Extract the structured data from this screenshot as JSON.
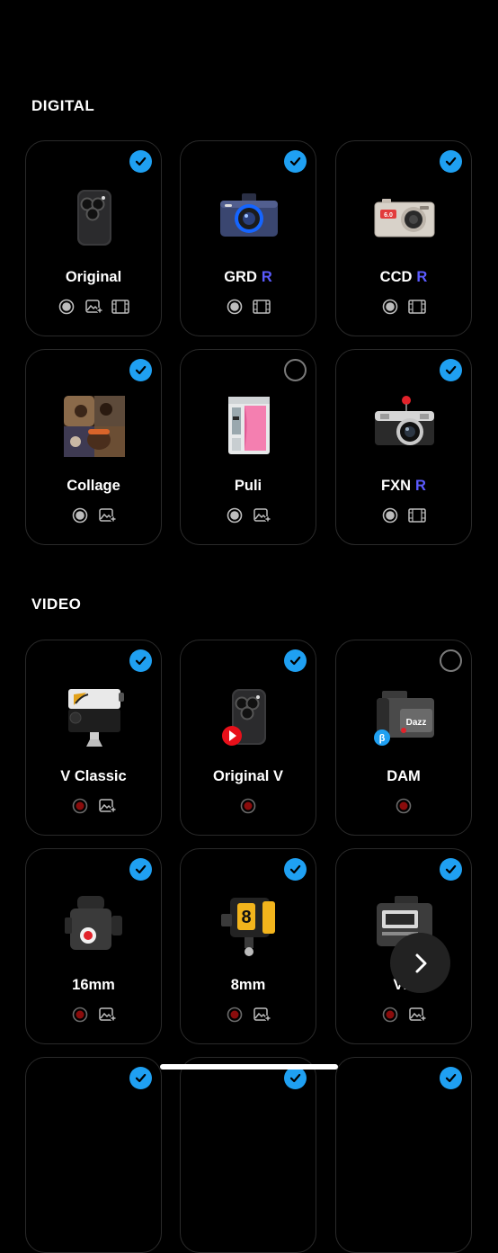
{
  "sections": [
    {
      "title": "DIGITAL",
      "cards": [
        {
          "name": "Original",
          "suffix": "",
          "checked": true,
          "icon": "phone-camera-icon",
          "features": [
            "shutter-icon",
            "photo-import-icon",
            "film-icon"
          ]
        },
        {
          "name": "GRD",
          "suffix": "R",
          "checked": true,
          "icon": "blue-digital-camera-icon",
          "features": [
            "shutter-icon",
            "film-icon"
          ]
        },
        {
          "name": "CCD",
          "suffix": "R",
          "checked": true,
          "icon": "silver-compact-camera-icon",
          "features": [
            "shutter-icon",
            "film-icon"
          ]
        },
        {
          "name": "Collage",
          "suffix": "",
          "checked": true,
          "icon": "photo-collage-icon",
          "features": [
            "shutter-icon",
            "photo-import-icon"
          ]
        },
        {
          "name": "Puli",
          "suffix": "",
          "checked": false,
          "icon": "photo-booth-icon",
          "features": [
            "shutter-icon",
            "photo-import-icon"
          ]
        },
        {
          "name": "FXN",
          "suffix": "R",
          "checked": true,
          "icon": "rangefinder-camera-icon",
          "features": [
            "shutter-icon",
            "film-icon"
          ]
        }
      ]
    },
    {
      "title": "VIDEO",
      "cards": [
        {
          "name": "V Classic",
          "suffix": "",
          "checked": true,
          "icon": "vintage-camcorder-icon",
          "features": [
            "record-icon",
            "photo-import-icon"
          ]
        },
        {
          "name": "Original V",
          "suffix": "",
          "checked": true,
          "icon": "phone-video-icon",
          "features": [
            "record-icon"
          ]
        },
        {
          "name": "DAM",
          "suffix": "",
          "checked": false,
          "icon": "dazz-camcorder-icon",
          "features": [
            "record-icon"
          ]
        },
        {
          "name": "16mm",
          "suffix": "",
          "checked": true,
          "icon": "16mm-camera-icon",
          "features": [
            "record-icon",
            "photo-import-icon"
          ]
        },
        {
          "name": "8mm",
          "suffix": "",
          "checked": true,
          "icon": "8mm-camera-icon",
          "features": [
            "record-icon",
            "photo-import-icon"
          ]
        },
        {
          "name": "VH",
          "suffix": "",
          "checked": true,
          "icon": "vhs-camcorder-icon",
          "features": [
            "record-icon",
            "photo-import-icon"
          ]
        }
      ]
    }
  ],
  "colors": {
    "check": "#1fa0f2",
    "r_badge": "#5b5bff",
    "card_border": "#2a2a2a"
  },
  "next_button": {
    "icon": "chevron-right-icon"
  }
}
